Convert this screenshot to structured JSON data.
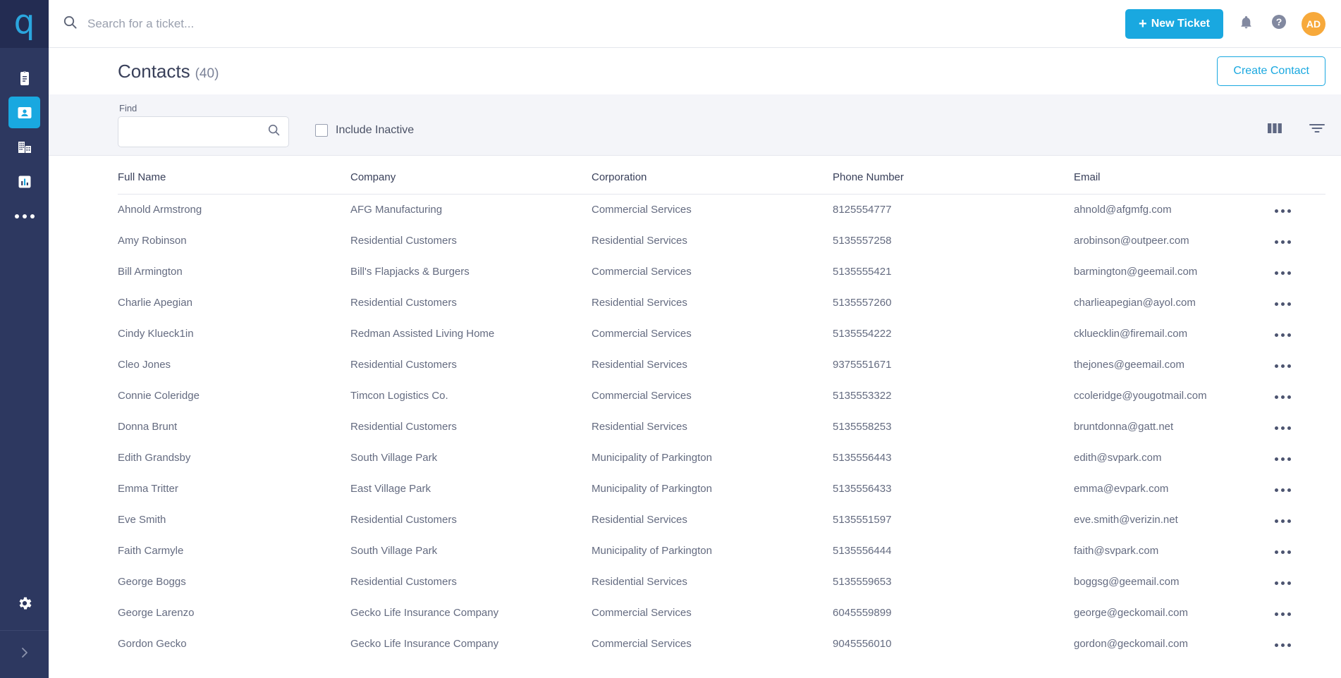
{
  "sidebar": {
    "logo_text": "q",
    "items": [
      {
        "name": "tickets",
        "icon": "clipboard-icon",
        "active": false
      },
      {
        "name": "contacts",
        "icon": "contact-card-icon",
        "active": true
      },
      {
        "name": "companies",
        "icon": "building-icon",
        "active": false
      },
      {
        "name": "reports",
        "icon": "bar-chart-icon",
        "active": false
      },
      {
        "name": "more",
        "icon": "ellipsis-icon",
        "active": false
      }
    ],
    "settings_icon": "gear-icon",
    "expand_icon": "chevron-right-icon"
  },
  "topbar": {
    "search_placeholder": "Search for a ticket...",
    "search_value": "",
    "search_icon": "search-icon",
    "new_ticket_label": "New Ticket",
    "new_ticket_plus": "+",
    "notifications_icon": "bell-icon",
    "help_icon": "question-circle-icon",
    "avatar_initials": "AD"
  },
  "page": {
    "title": "Contacts",
    "count": "(40)",
    "create_button_label": "Create Contact"
  },
  "filters": {
    "find_label": "Find",
    "find_value": "",
    "find_placeholder": "",
    "find_icon": "search-icon",
    "include_inactive_label": "Include Inactive",
    "include_inactive_checked": false,
    "columns_icon": "columns-icon",
    "filter_icon": "filter-funnel-icon"
  },
  "table": {
    "columns": [
      "Full Name",
      "Company",
      "Corporation",
      "Phone Number",
      "Email"
    ],
    "row_action_icon": "ellipsis-horizontal-icon",
    "rows": [
      {
        "full_name": "Ahnold Armstrong",
        "company": "AFG Manufacturing",
        "corporation": "Commercial Services",
        "phone": "8125554777",
        "email": "ahnold@afgmfg.com"
      },
      {
        "full_name": "Amy Robinson",
        "company": "Residential Customers",
        "corporation": "Residential Services",
        "phone": "5135557258",
        "email": "arobinson@outpeer.com"
      },
      {
        "full_name": "Bill Armington",
        "company": "Bill's Flapjacks & Burgers",
        "corporation": "Commercial Services",
        "phone": "5135555421",
        "email": "barmington@geemail.com"
      },
      {
        "full_name": "Charlie Apegian",
        "company": "Residential Customers",
        "corporation": "Residential Services",
        "phone": "5135557260",
        "email": "charlieapegian@ayol.com"
      },
      {
        "full_name": "Cindy Klueck1in",
        "company": "Redman Assisted Living Home",
        "corporation": "Commercial Services",
        "phone": "5135554222",
        "email": "ckluecklin@firemail.com"
      },
      {
        "full_name": "Cleo Jones",
        "company": "Residential Customers",
        "corporation": "Residential Services",
        "phone": "9375551671",
        "email": "thejones@geemail.com"
      },
      {
        "full_name": "Connie Coleridge",
        "company": "Timcon Logistics Co.",
        "corporation": "Commercial Services",
        "phone": "5135553322",
        "email": "ccoleridge@yougotmail.com"
      },
      {
        "full_name": "Donna Brunt",
        "company": "Residential Customers",
        "corporation": "Residential Services",
        "phone": "5135558253",
        "email": "bruntdonna@gatt.net"
      },
      {
        "full_name": "Edith Grandsby",
        "company": "South Village Park",
        "corporation": "Municipality of Parkington",
        "phone": "5135556443",
        "email": "edith@svpark.com"
      },
      {
        "full_name": "Emma Tritter",
        "company": "East Village Park",
        "corporation": "Municipality of Parkington",
        "phone": "5135556433",
        "email": "emma@evpark.com"
      },
      {
        "full_name": "Eve Smith",
        "company": "Residential Customers",
        "corporation": "Residential Services",
        "phone": "5135551597",
        "email": "eve.smith@verizin.net"
      },
      {
        "full_name": "Faith Carmyle",
        "company": "South Village Park",
        "corporation": "Municipality of Parkington",
        "phone": "5135556444",
        "email": "faith@svpark.com"
      },
      {
        "full_name": "George Boggs",
        "company": "Residential Customers",
        "corporation": "Residential Services",
        "phone": "5135559653",
        "email": "boggsg@geemail.com"
      },
      {
        "full_name": "George Larenzo",
        "company": "Gecko Life Insurance Company",
        "corporation": "Commercial Services",
        "phone": "6045559899",
        "email": "george@geckomail.com"
      },
      {
        "full_name": "Gordon Gecko",
        "company": "Gecko Life Insurance Company",
        "corporation": "Commercial Services",
        "phone": "9045556010",
        "email": "gordon@geckomail.com"
      }
    ]
  },
  "colors": {
    "sidebar_bg": "#2d3860",
    "sidebar_logo_bg": "#232c52",
    "accent_blue": "#19a8e0",
    "logo_blue": "#2ba6de",
    "avatar_orange": "#f7a93b",
    "filter_bar_bg": "#f4f5f9",
    "text_dark": "#39405a",
    "text_body": "#646b80"
  }
}
